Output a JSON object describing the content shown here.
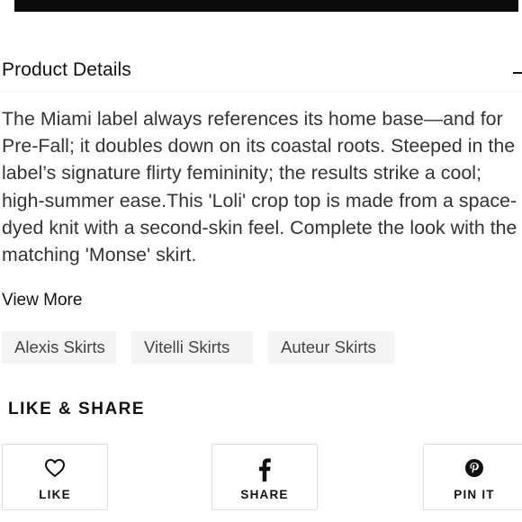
{
  "product_details": {
    "title": "Product Details",
    "collapse_symbol": "–",
    "description": "The Miami label always references its home base—and for Pre-Fall; it doubles down on its coastal roots. Steeped in the label’s signature flirty femininity; the results strike a cool; high-summer ease.This 'Loli' crop top is made from a space-dyed knit with a second-skin feel. Complete the look with the matching 'Monse' skirt."
  },
  "view_more": {
    "title": "View More",
    "tags": [
      "Alexis Skirts",
      "Vitelli Skirts",
      "Auteur Skirts"
    ]
  },
  "like_share": {
    "title": "LIKE & SHARE",
    "buttons": [
      {
        "label": "LIKE",
        "icon": "heart-icon"
      },
      {
        "label": "SHARE",
        "icon": "facebook-icon"
      },
      {
        "label": "PIN IT",
        "icon": "pinterest-icon"
      }
    ]
  },
  "colors": {
    "top_bar": "#0b0b0b",
    "tag_bg": "#f3f3f3",
    "border": "#dedede"
  }
}
